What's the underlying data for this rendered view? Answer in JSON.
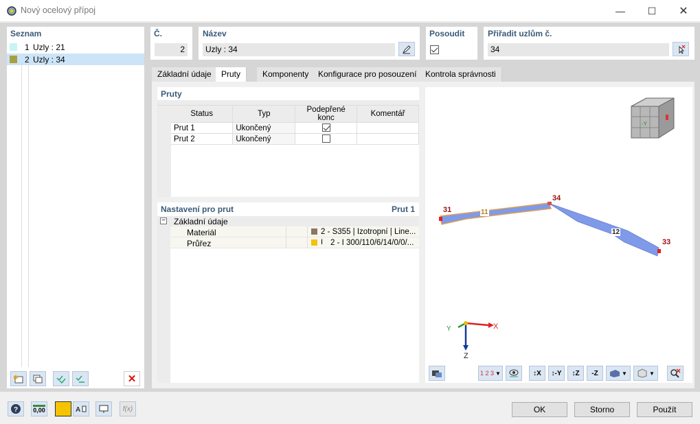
{
  "window": {
    "title": "Nový ocelový přípoj"
  },
  "list": {
    "header": "Seznam",
    "items": [
      {
        "num": "1",
        "label": "Uzly : 21",
        "color": "#c8f4f4"
      },
      {
        "num": "2",
        "label": "Uzly : 34",
        "color": "#a8a040"
      }
    ]
  },
  "fields": {
    "no_label": "Č.",
    "no_value": "2",
    "name_label": "Název",
    "name_value": "Uzly : 34",
    "assess_label": "Posoudit",
    "assign_label": "Přiřadit uzlům č.",
    "assign_value": "34"
  },
  "tabs": [
    "Základní údaje",
    "Pruty",
    "Komponenty",
    "Konfigurace pro posouzení",
    "Kontrola správnosti"
  ],
  "members": {
    "header": "Pruty",
    "columns": [
      "Status",
      "Typ",
      "Podepřené konc",
      "Komentář"
    ],
    "rows": [
      {
        "status": "Prut 1",
        "type": "Ukončený",
        "supported": true,
        "comment": ""
      },
      {
        "status": "Prut 2",
        "type": "Ukončený",
        "supported": false,
        "comment": ""
      }
    ]
  },
  "settings": {
    "header": "Nastavení pro prut",
    "target": "Prut 1",
    "group": "Základní údaje",
    "rows": [
      {
        "label": "Materiál",
        "value": "2 - S355 | Izotropní | Line...",
        "color": "#8b7765"
      },
      {
        "label": "Průřez",
        "value": "2 - I 300/110/6/14/0/0/...",
        "color": "#f3c20a"
      }
    ]
  },
  "view": {
    "node_labels": [
      "31",
      "34",
      "33"
    ],
    "member_labels": [
      "11",
      "12"
    ],
    "axes": {
      "x": "X",
      "y": "Y",
      "z": "Z"
    },
    "cube_label": "-Y"
  },
  "buttons": {
    "ok": "OK",
    "cancel": "Storno",
    "apply": "Použít"
  },
  "status": {
    "decimals": "0,00"
  }
}
